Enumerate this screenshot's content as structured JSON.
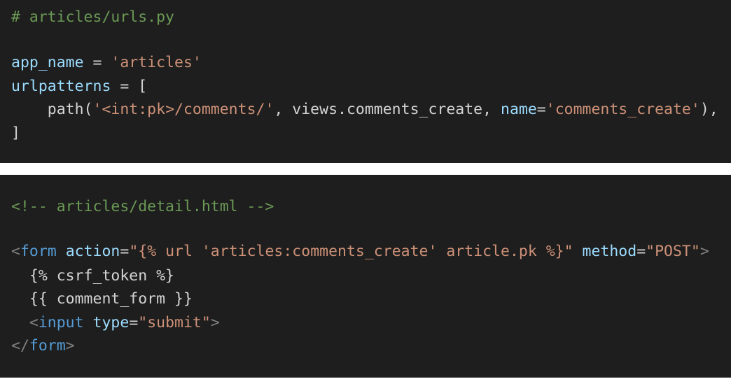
{
  "block1": {
    "line1": {
      "comment": "# articles/urls.py"
    },
    "line2": {
      "var": "app_name",
      "op": " = ",
      "str": "'articles'"
    },
    "line3": {
      "var": "urlpatterns",
      "op": " = ["
    },
    "line4": {
      "indent": "    ",
      "fn": "path(",
      "str1": "'<int:pk>/comments/'",
      "mid": ", views.comments_create, ",
      "kw": "name",
      "eq": "=",
      "str2": "'comments_create'",
      "end": "),"
    },
    "line5": {
      "text": "]"
    }
  },
  "block2": {
    "line1": {
      "comment": "<!-- articles/detail.html -->"
    },
    "line2": {
      "lt": "<",
      "tag": "form",
      "sp1": " ",
      "attr1": "action",
      "eq1": "=",
      "val1": "\"{% url 'articles:comments_create' article.pk %}\"",
      "sp2": " ",
      "attr2": "method",
      "eq2": "=",
      "val2": "\"POST\"",
      "gt": ">"
    },
    "line3": {
      "indent": "  ",
      "text": "{% csrf_token %}"
    },
    "line4": {
      "indent": "  ",
      "text": "{{ comment_form }}"
    },
    "line5": {
      "indent": "  ",
      "lt": "<",
      "tag": "input",
      "sp": " ",
      "attr": "type",
      "eq": "=",
      "val": "\"submit\"",
      "gt": ">"
    },
    "line6": {
      "lt": "</",
      "tag": "form",
      "gt": ">"
    }
  },
  "colors": {
    "background": "#1e1e1e",
    "comment": "#6a9955",
    "string": "#ce9178",
    "tag": "#569cd6",
    "attribute": "#9cdcfe",
    "text": "#d4d4d4",
    "page": "#ffffff"
  }
}
